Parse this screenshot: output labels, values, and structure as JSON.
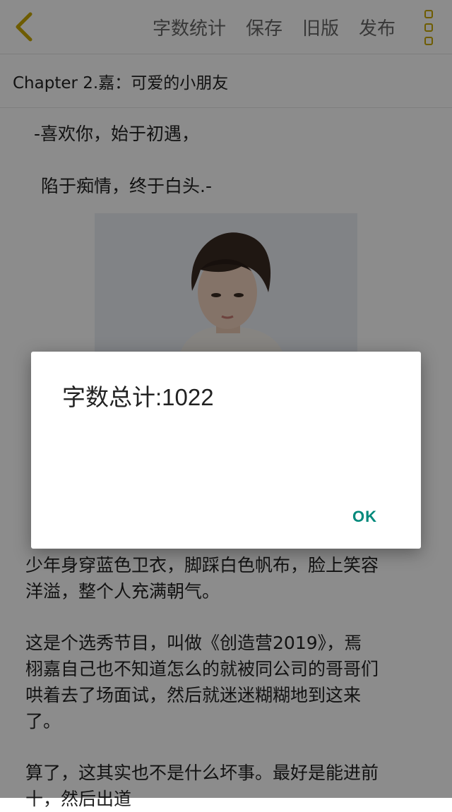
{
  "header": {
    "actions": [
      "字数统计",
      "保存",
      "旧版",
      "发布"
    ]
  },
  "chapter": {
    "title": "Chapter 2.嘉：可爱的小朋友"
  },
  "content": {
    "poem_line1": "-喜欢你，始于初遇，",
    "poem_line2": "陷于痴情，终于白头.-",
    "para1_line1": "少年身穿蓝色卫衣，脚踩白色帆布，脸上笑容",
    "para1_line2": "洋溢，整个人充满朝气。",
    "para2_line1": "这是个选秀节目，叫做《创造营2019》，焉",
    "para2_line2": "栩嘉自己也不知道怎么的就被同公司的哥哥们",
    "para2_line3": "哄着去了场面试，然后就迷迷糊糊地到这来",
    "para2_line4": "了。",
    "para3_line1": "算了，这其实也不是什么坏事。最好是能进前",
    "para3_line2": "十，然后出道"
  },
  "dialog": {
    "message": "字数总计:1022",
    "ok_label": "OK"
  },
  "colors": {
    "back_icon": "#c8a800",
    "ok_button": "#00897b"
  }
}
